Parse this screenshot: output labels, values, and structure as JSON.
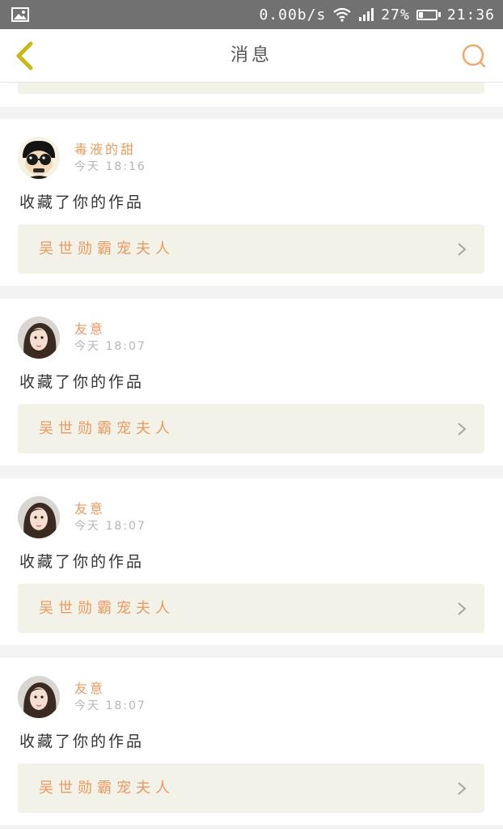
{
  "status_bar": {
    "net_speed": "0.00b/s",
    "battery": "27%",
    "battery_level": 0.27,
    "clock": "21:36"
  },
  "header": {
    "title": "消息"
  },
  "colors": {
    "accent": "#e99a62",
    "back_arrow": "#c9b716",
    "search_icon": "#f0a86c",
    "work_box_bg": "#f3f2e8"
  },
  "messages": [
    {
      "username": "毒液的甜",
      "time": "今天 18:16",
      "action": "收藏了你的作品",
      "work_title": "吴世勋霸宠夫人",
      "avatar_icon": "cartoon-avatar-icon"
    },
    {
      "username": "友意",
      "time": "今天 18:07",
      "action": "收藏了你的作品",
      "work_title": "吴世勋霸宠夫人",
      "avatar_icon": "girl-photo-avatar-icon"
    },
    {
      "username": "友意",
      "time": "今天 18:07",
      "action": "收藏了你的作品",
      "work_title": "吴世勋霸宠夫人",
      "avatar_icon": "girl-photo-avatar-icon"
    },
    {
      "username": "友意",
      "time": "今天 18:07",
      "action": "收藏了你的作品",
      "work_title": "吴世勋霸宠夫人",
      "avatar_icon": "girl-photo-avatar-icon"
    }
  ]
}
